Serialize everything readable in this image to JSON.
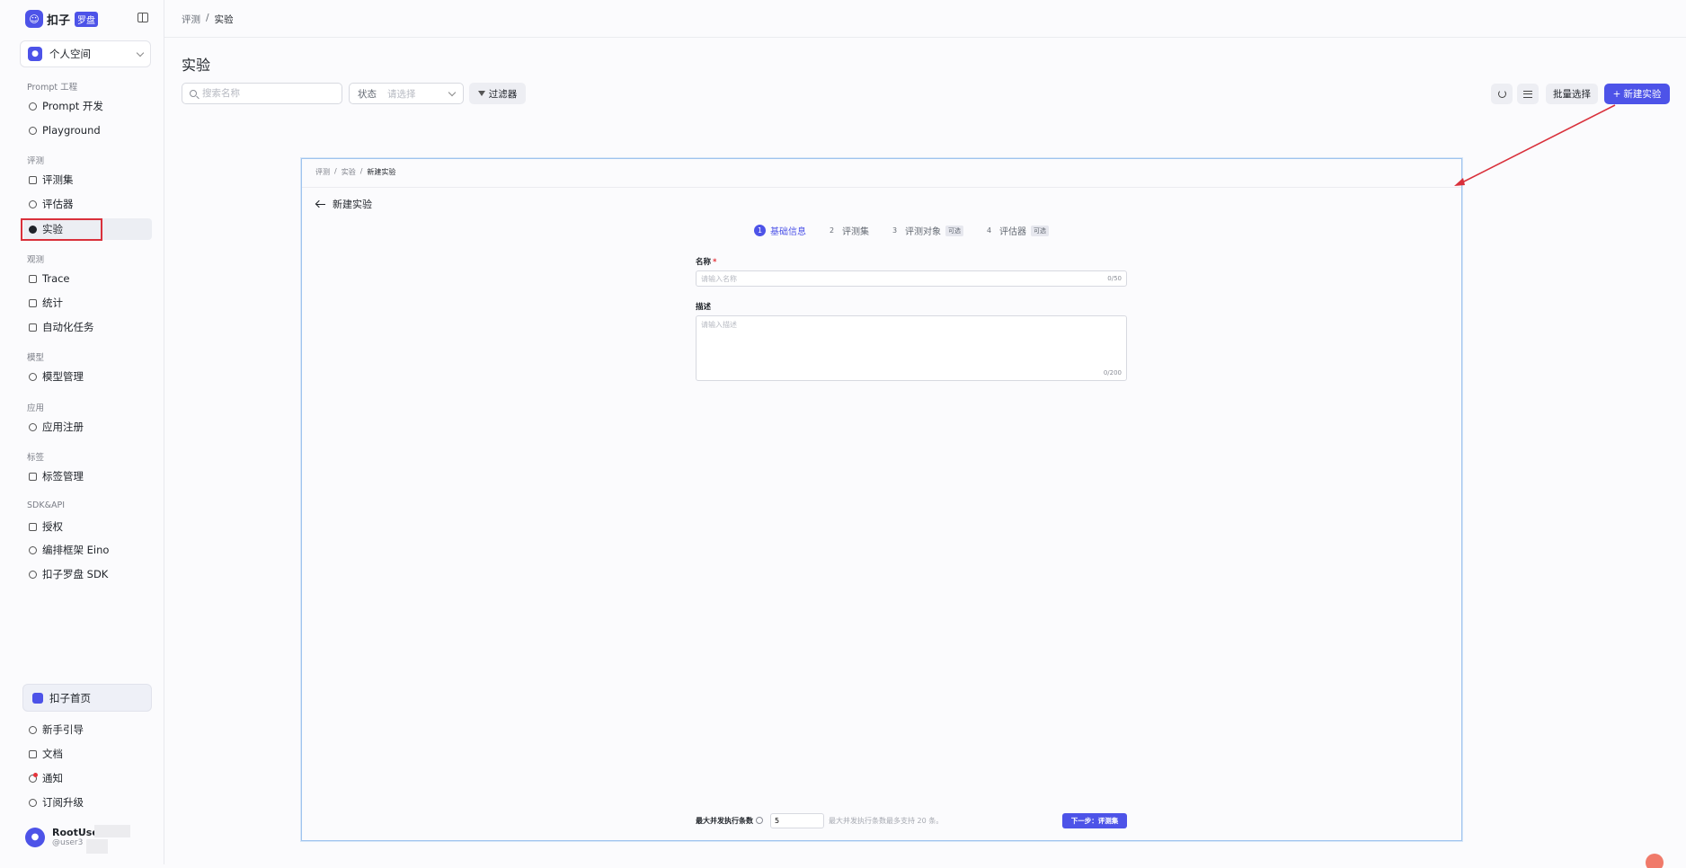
{
  "sidebar": {
    "logo_text": "扣子",
    "logo_badge": "罗盘",
    "space": "个人空间",
    "groups": {
      "prompt": "Prompt 工程",
      "eval": "评测",
      "observe": "观测",
      "model": "模型",
      "app": "应用",
      "tag": "标签",
      "sdk": "SDK&API"
    },
    "items": {
      "prompt_dev": "Prompt 开发",
      "playground": "Playground",
      "dataset": "评测集",
      "evaluator": "评估器",
      "experiment": "实验",
      "trace": "Trace",
      "stats": "统计",
      "automation": "自动化任务",
      "model_mgmt": "模型管理",
      "app_reg": "应用注册",
      "tag_mgmt": "标签管理",
      "auth": "授权",
      "eino": "编排框架 Eino",
      "sdk": "扣子罗盘 SDK"
    },
    "home": "扣子首页",
    "bottom": {
      "guide": "新手引导",
      "docs": "文档",
      "notify": "通知",
      "upgrade": "订阅升级"
    },
    "user": {
      "name": "RootUser",
      "handle": "@user3"
    }
  },
  "breadcrumb": {
    "parent": "评测",
    "sep": "/",
    "current": "实验"
  },
  "page": {
    "title": "实验",
    "search_placeholder": "搜索名称",
    "status_label": "状态",
    "status_placeholder": "请选择",
    "filter": "过滤器",
    "batch_select": "批量选择",
    "new_experiment": "新建实验"
  },
  "panel": {
    "crumb": {
      "a": "评测",
      "b": "实验",
      "c": "新建实验",
      "sep": "/"
    },
    "title": "新建实验",
    "steps": [
      {
        "num": "1",
        "label": "基础信息"
      },
      {
        "num": "2",
        "label": "评测集"
      },
      {
        "num": "3",
        "label": "评测对象",
        "tag": "可选"
      },
      {
        "num": "4",
        "label": "评估器",
        "tag": "可选"
      }
    ],
    "name_label": "名称",
    "name_placeholder": "请输入名称",
    "name_counter": "0/50",
    "desc_label": "描述",
    "desc_placeholder": "请输入描述",
    "desc_counter": "0/200",
    "concurrency_label": "最大并发执行条数",
    "concurrency_value": "5",
    "concurrency_hint": "最大并发执行条数最多支持 20 条。",
    "next_button": "下一步：评测集"
  },
  "colors": {
    "accent": "#4d53e8",
    "annotation": "#d9303b"
  }
}
